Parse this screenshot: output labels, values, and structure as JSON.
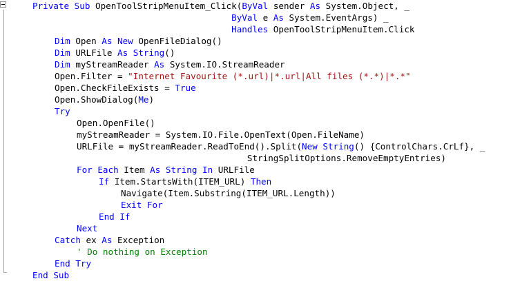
{
  "colors": {
    "keyword": "#0000ff",
    "string": "#a31515",
    "comment": "#008000",
    "text": "#000000",
    "background": "#ffffff"
  },
  "lines": [
    {
      "indent": 0,
      "tokens": [
        {
          "t": "kw",
          "v": "Private Sub "
        },
        {
          "t": "txt",
          "v": "OpenToolStripMenuItem_Click("
        },
        {
          "t": "kw",
          "v": "ByVal"
        },
        {
          "t": "txt",
          "v": " sender "
        },
        {
          "t": "kw",
          "v": "As"
        },
        {
          "t": "txt",
          "v": " System.Object, _"
        }
      ]
    },
    {
      "indent": 0,
      "tokens": [
        {
          "t": "txt",
          "v": "                                      "
        },
        {
          "t": "kw",
          "v": "ByVal"
        },
        {
          "t": "txt",
          "v": " e "
        },
        {
          "t": "kw",
          "v": "As"
        },
        {
          "t": "txt",
          "v": " System.EventArgs) _"
        }
      ]
    },
    {
      "indent": 0,
      "tokens": [
        {
          "t": "txt",
          "v": "                                      "
        },
        {
          "t": "kw",
          "v": "Handles"
        },
        {
          "t": "txt",
          "v": " OpenToolStripMenuItem.Click"
        }
      ]
    },
    {
      "indent": 1,
      "tokens": [
        {
          "t": "kw",
          "v": "Dim"
        },
        {
          "t": "txt",
          "v": " Open "
        },
        {
          "t": "kw",
          "v": "As New"
        },
        {
          "t": "txt",
          "v": " OpenFileDialog()"
        }
      ]
    },
    {
      "indent": 1,
      "tokens": [
        {
          "t": "kw",
          "v": "Dim"
        },
        {
          "t": "txt",
          "v": " URLFile "
        },
        {
          "t": "kw",
          "v": "As String"
        },
        {
          "t": "txt",
          "v": "()"
        }
      ]
    },
    {
      "indent": 1,
      "tokens": [
        {
          "t": "kw",
          "v": "Dim"
        },
        {
          "t": "txt",
          "v": " myStreamReader "
        },
        {
          "t": "kw",
          "v": "As"
        },
        {
          "t": "txt",
          "v": " System.IO.StreamReader"
        }
      ]
    },
    {
      "indent": 1,
      "tokens": [
        {
          "t": "txt",
          "v": "Open.Filter = "
        },
        {
          "t": "str",
          "v": "\"Internet Favourite (*.url)|*.url|All files (*.*)|*.*\""
        }
      ]
    },
    {
      "indent": 1,
      "tokens": [
        {
          "t": "txt",
          "v": "Open.CheckFileExists = "
        },
        {
          "t": "kw",
          "v": "True"
        }
      ]
    },
    {
      "indent": 1,
      "tokens": [
        {
          "t": "txt",
          "v": "Open.ShowDialog("
        },
        {
          "t": "kw",
          "v": "Me"
        },
        {
          "t": "txt",
          "v": ")"
        }
      ]
    },
    {
      "indent": 1,
      "tokens": [
        {
          "t": "kw",
          "v": "Try"
        }
      ]
    },
    {
      "indent": 2,
      "tokens": [
        {
          "t": "txt",
          "v": "Open.OpenFile()"
        }
      ]
    },
    {
      "indent": 2,
      "tokens": [
        {
          "t": "txt",
          "v": "myStreamReader = System.IO.File.OpenText(Open.FileName)"
        }
      ]
    },
    {
      "indent": 2,
      "tokens": [
        {
          "t": "txt",
          "v": "URLFile = myStreamReader.ReadToEnd().Split("
        },
        {
          "t": "kw",
          "v": "New String"
        },
        {
          "t": "txt",
          "v": "() {ControlChars.CrLf}, _"
        }
      ]
    },
    {
      "indent": 0,
      "tokens": [
        {
          "t": "txt",
          "v": "                                         StringSplitOptions.RemoveEmptyEntries)"
        }
      ]
    },
    {
      "indent": 2,
      "tokens": [
        {
          "t": "kw",
          "v": "For Each"
        },
        {
          "t": "txt",
          "v": " Item "
        },
        {
          "t": "kw",
          "v": "As String In"
        },
        {
          "t": "txt",
          "v": " URLFile"
        }
      ]
    },
    {
      "indent": 3,
      "tokens": [
        {
          "t": "kw",
          "v": "If"
        },
        {
          "t": "txt",
          "v": " Item.StartsWith(ITEM_URL) "
        },
        {
          "t": "kw",
          "v": "Then"
        }
      ]
    },
    {
      "indent": 4,
      "tokens": [
        {
          "t": "txt",
          "v": "Navigate(Item.Substring(ITEM_URL.Length))"
        }
      ]
    },
    {
      "indent": 4,
      "tokens": [
        {
          "t": "kw",
          "v": "Exit For"
        }
      ]
    },
    {
      "indent": 3,
      "tokens": [
        {
          "t": "kw",
          "v": "End If"
        }
      ]
    },
    {
      "indent": 2,
      "tokens": [
        {
          "t": "kw",
          "v": "Next"
        }
      ]
    },
    {
      "indent": 1,
      "tokens": [
        {
          "t": "kw",
          "v": "Catch"
        },
        {
          "t": "txt",
          "v": " ex "
        },
        {
          "t": "kw",
          "v": "As"
        },
        {
          "t": "txt",
          "v": " Exception"
        }
      ]
    },
    {
      "indent": 2,
      "tokens": [
        {
          "t": "cmt",
          "v": "' Do nothing on Exception"
        }
      ]
    },
    {
      "indent": 1,
      "tokens": [
        {
          "t": "kw",
          "v": "End Try"
        }
      ]
    },
    {
      "indent": 0,
      "tokens": [
        {
          "t": "kw",
          "v": "End Sub"
        }
      ]
    }
  ]
}
